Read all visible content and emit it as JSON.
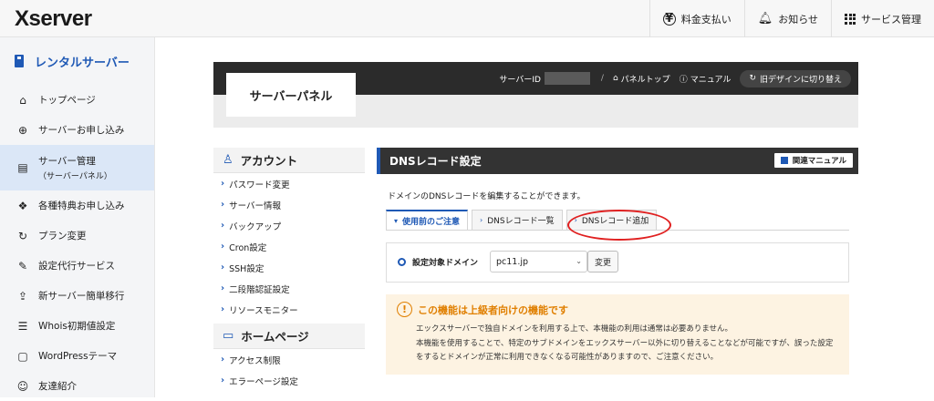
{
  "header": {
    "logo": "Xserver",
    "nav": [
      {
        "label": "料金支払い",
        "icon": "yen-icon"
      },
      {
        "label": "お知らせ",
        "icon": "bell-icon"
      },
      {
        "label": "サービス管理",
        "icon": "grid-icon"
      }
    ]
  },
  "sidebar": {
    "title": "レンタルサーバー",
    "items": [
      {
        "label": "トップページ",
        "icon": "home-icon",
        "glyph": "⌂"
      },
      {
        "label": "サーバーお申し込み",
        "icon": "plus-circle-icon",
        "glyph": "⊕"
      },
      {
        "label": "サーバー管理",
        "sub": "（サーバーパネル）",
        "icon": "server-icon",
        "glyph": "▤",
        "active": true
      },
      {
        "label": "各種特典お申し込み",
        "icon": "gift-icon",
        "glyph": "❖"
      },
      {
        "label": "プラン変更",
        "icon": "refresh-icon",
        "glyph": "↻"
      },
      {
        "label": "設定代行サービス",
        "icon": "wrench-icon",
        "glyph": "✎"
      },
      {
        "label": "新サーバー簡単移行",
        "icon": "upload-icon",
        "glyph": "⇪"
      },
      {
        "label": "Whois初期値設定",
        "icon": "document-icon",
        "glyph": "☰"
      },
      {
        "label": "WordPressテーマ",
        "icon": "window-icon",
        "glyph": "▢"
      },
      {
        "label": "友達紹介",
        "icon": "person-icon",
        "glyph": "☺"
      }
    ]
  },
  "panel": {
    "title": "サーバーパネル",
    "server_id_label": "サーバーID",
    "separator": "/",
    "top_link": "パネルトップ",
    "manual_link": "マニュアル",
    "old_design": "旧デザインに切り替え"
  },
  "menu": {
    "account_head": "アカウント",
    "account_items": [
      "パスワード変更",
      "サーバー情報",
      "バックアップ",
      "Cron設定",
      "SSH設定",
      "二段階認証設定",
      "リソースモニター"
    ],
    "homepage_head": "ホームページ",
    "homepage_items": [
      "アクセス制限",
      "エラーページ設定"
    ]
  },
  "dns": {
    "title": "DNSレコード設定",
    "manual_btn": "関連マニュアル",
    "description": "ドメインのDNSレコードを編集することができます。",
    "tabs": [
      {
        "label": "使用前のご注意",
        "active": true
      },
      {
        "label": "DNSレコード一覧",
        "active": false
      },
      {
        "label": "DNSレコード追加",
        "active": false
      }
    ],
    "domain_label": "設定対象ドメイン",
    "domain_value": "pc11.jp",
    "change_btn": "変更",
    "warning_title": "この機能は上級者向けの機能です",
    "warning_lines": [
      "エックスサーバーで独自ドメインを利用する上で、本機能の利用は通常は必要ありません。",
      "本機能を使用することで、特定のサブドメインをエックスサーバー以外に切り替えることなどが可能ですが、誤った設定",
      "をするとドメインが正常に利用できなくなる可能性がありますので、ご注意ください。"
    ]
  },
  "colors": {
    "accent": "#1f59b5",
    "warning": "#e07f00",
    "annotation": "#e02020"
  }
}
